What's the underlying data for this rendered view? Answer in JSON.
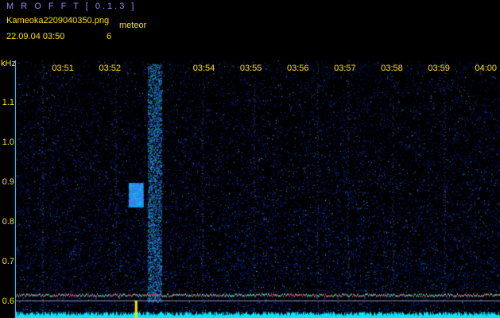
{
  "header": {
    "app_title": "M R O F F T  [ 0.1.3 ]",
    "file_name": "Kameoka2209040350.png",
    "meteor_label": "meteor",
    "datetime": "22.09.04  03:50",
    "meteor_count": "6"
  },
  "chart_data": {
    "type": "heatmap",
    "ylabel": "kHz",
    "ylim": [
      0.58,
      1.2
    ],
    "y_ticks": [
      "1.1",
      "1.0",
      "0.9",
      "0.8",
      "0.7",
      "0.6"
    ],
    "x_ticks": [
      "03:51",
      "03:52",
      "03:54",
      "03:55",
      "03:56",
      "03:57",
      "03:58",
      "03:59",
      "04:00"
    ],
    "x_minutes": [
      1,
      2,
      4,
      5,
      6,
      7,
      8,
      9,
      10
    ],
    "xlim": [
      0.0,
      10.3
    ],
    "carrier_khz": 0.62,
    "meteor_echoes": [
      {
        "time_min": 2.95,
        "khz_low": 0.6,
        "khz_high": 1.2
      },
      {
        "time_min": 2.55,
        "khz_low": 0.84,
        "khz_high": 0.9
      }
    ],
    "colors": {
      "background": "#000000",
      "noise": "#1e3cff",
      "label": "#ffe000",
      "axis": "#00c8ff"
    }
  }
}
